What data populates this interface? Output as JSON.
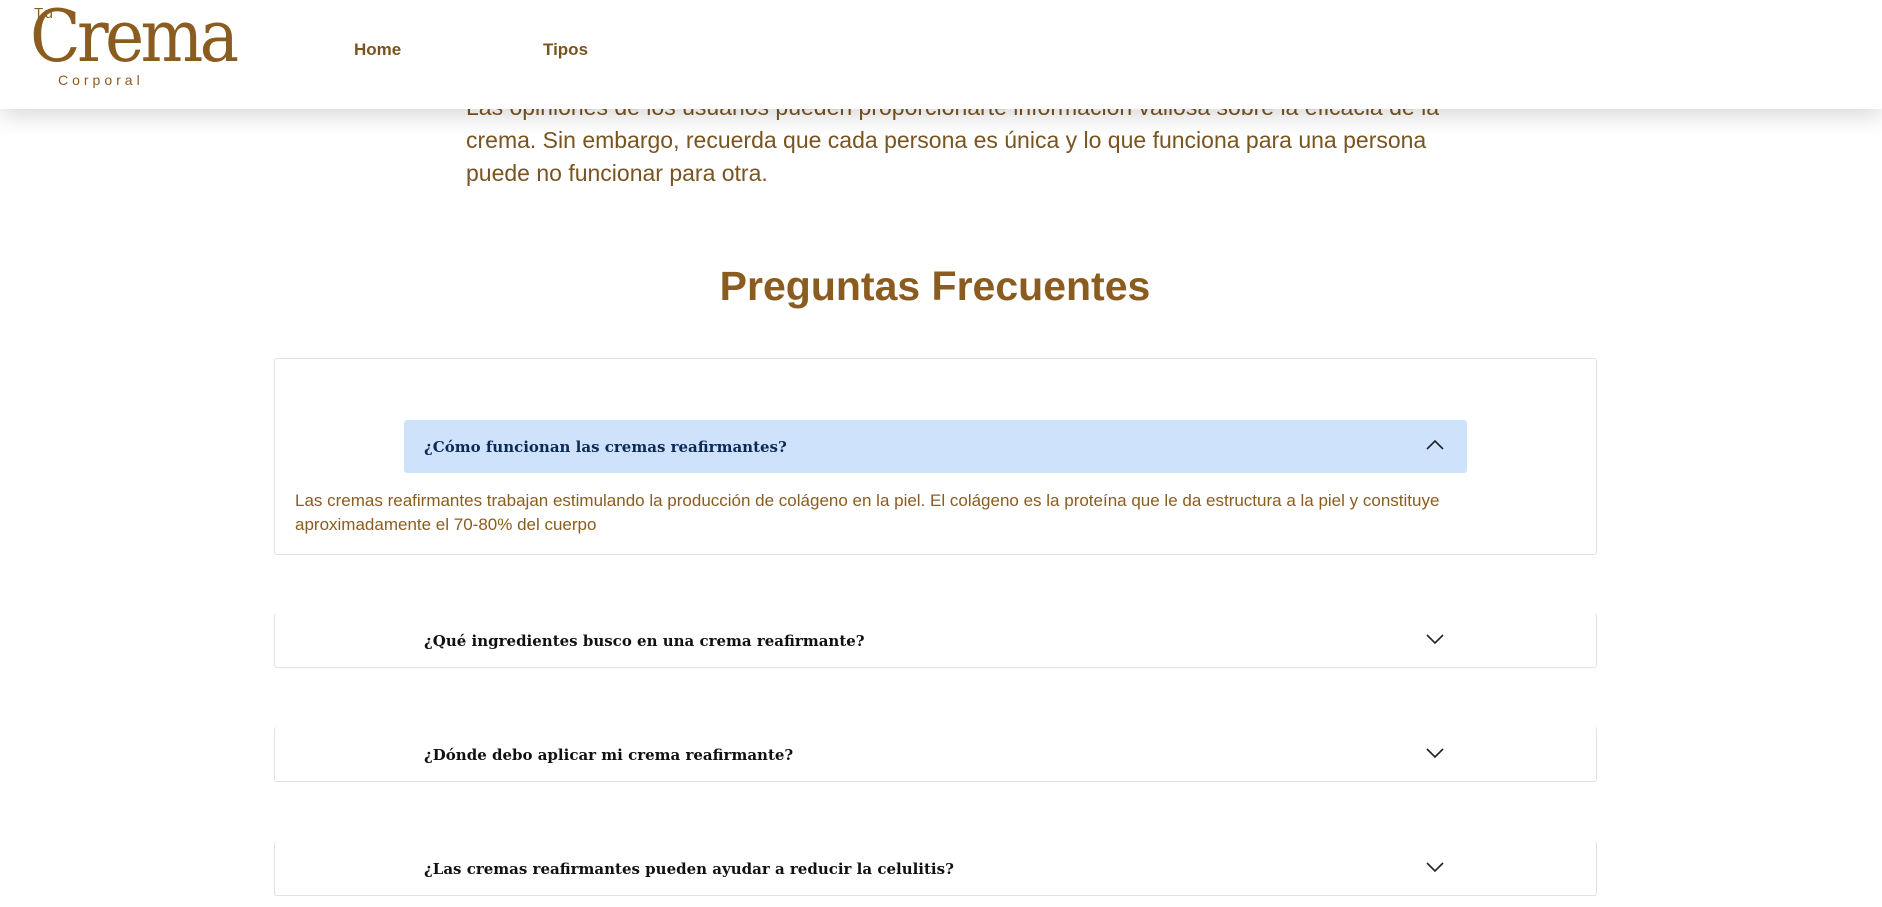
{
  "header": {
    "logo": {
      "tu": "Tu",
      "crema": "Crema",
      "corporal": "Corporal"
    },
    "nav": [
      {
        "label": "Home"
      },
      {
        "label": "Tipos"
      }
    ]
  },
  "intro": {
    "text": "Las opiniones de los usuarios pueden proporcionarte información valiosa sobre la eficacia de la crema. Sin embargo, recuerda que cada persona es única y lo que funciona para una persona puede no funcionar para otra."
  },
  "faq": {
    "title": "Preguntas Frecuentes",
    "items": [
      {
        "question": "¿Cómo funcionan las cremas reafirmantes?",
        "answer": "Las cremas reafirmantes trabajan estimulando la producción de colágeno en la piel. El colágeno es la proteína que le da estructura a la piel y constituye aproximadamente el 70-80% del cuerpo",
        "expanded": true,
        "icon": "chevron-up-icon"
      },
      {
        "question": "¿Qué ingredientes busco en una crema reafirmante?",
        "expanded": false,
        "icon": "chevron-down-icon"
      },
      {
        "question": "¿Dónde debo aplicar mi crema reafirmante?",
        "expanded": false,
        "icon": "chevron-down-icon"
      },
      {
        "question": "¿Las cremas reafirmantes pueden ayudar a reducir la celulitis?",
        "expanded": false,
        "icon": "chevron-down-icon"
      }
    ]
  },
  "colors": {
    "brand": "#8a5c1f",
    "text_brown": "#7a5420",
    "active_question_bg": "#cfe2fc",
    "active_question_text": "#0b2a55"
  }
}
